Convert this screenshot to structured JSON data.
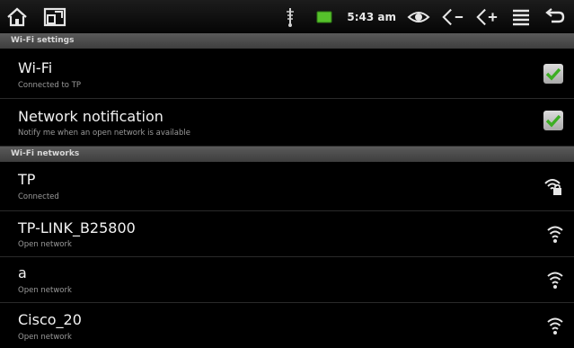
{
  "status_bar": {
    "time": "5:43 am",
    "left_icons": [
      "home-icon",
      "recent-apps-icon"
    ],
    "right_icons": [
      "usb-icon",
      "battery-icon",
      "eye-icon",
      "volume-down-icon",
      "volume-up-icon",
      "menu-icon",
      "back-icon"
    ],
    "battery_color": "#56c12b"
  },
  "sections": {
    "settings_header": "Wi-Fi settings",
    "networks_header": "Wi-Fi networks"
  },
  "settings": [
    {
      "title": "Wi-Fi",
      "summary": "Connected to TP",
      "checked": true
    },
    {
      "title": "Network notification",
      "summary": "Notify me when an open network is available",
      "checked": true
    }
  ],
  "networks": [
    {
      "ssid": "TP",
      "status": "Connected",
      "icon": "wifi-locked-icon"
    },
    {
      "ssid": "TP-LINK_B25800",
      "status": "Open network",
      "icon": "wifi-signal-icon"
    },
    {
      "ssid": "a",
      "status": "Open network",
      "icon": "wifi-signal-icon"
    },
    {
      "ssid": "Cisco_20",
      "status": "Open network",
      "icon": "wifi-signal-icon"
    }
  ],
  "colors": {
    "check_green": "#3cae23",
    "header_bg": "#4b4b4b"
  }
}
